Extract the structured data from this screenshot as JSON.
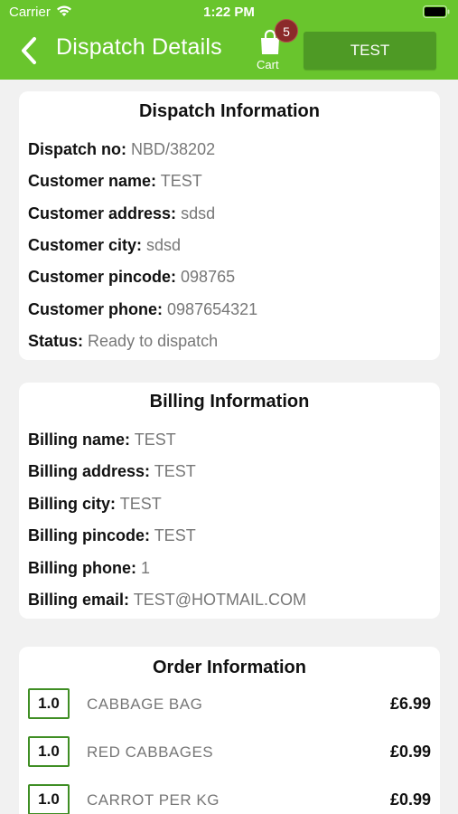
{
  "status_bar": {
    "carrier": "Carrier",
    "time": "1:22 PM"
  },
  "header": {
    "title": "Dispatch Details",
    "cart_label": "Cart",
    "cart_count": "5",
    "action_button": "TEST",
    "colors": {
      "bar": "#69c52d",
      "button": "#4e9a25",
      "badge": "#8b2a2a"
    }
  },
  "dispatch": {
    "title": "Dispatch Information",
    "rows": [
      {
        "label": "Dispatch no:",
        "value": "NBD/38202"
      },
      {
        "label": "Customer name:",
        "value": "TEST"
      },
      {
        "label": "Customer address:",
        "value": "sdsd"
      },
      {
        "label": "Customer city:",
        "value": "sdsd"
      },
      {
        "label": "Customer pincode:",
        "value": "098765"
      },
      {
        "label": "Customer phone:",
        "value": "0987654321"
      },
      {
        "label": "Status:",
        "value": "Ready to dispatch"
      }
    ]
  },
  "billing": {
    "title": "Billing Information",
    "rows": [
      {
        "label": "Billing name:",
        "value": "TEST"
      },
      {
        "label": "Billing address:",
        "value": "TEST"
      },
      {
        "label": "Billing city:",
        "value": "TEST"
      },
      {
        "label": "Billing pincode:",
        "value": "TEST"
      },
      {
        "label": "Billing phone:",
        "value": "1"
      },
      {
        "label": "Billing email:",
        "value": "TEST@HOTMAIL.COM"
      }
    ]
  },
  "order": {
    "title": "Order Information",
    "items": [
      {
        "qty": "1.0",
        "name": "CABBAGE BAG",
        "price": "£6.99"
      },
      {
        "qty": "1.0",
        "name": "RED CABBAGES",
        "price": "£0.99"
      },
      {
        "qty": "1.0",
        "name": "CARROT PER KG",
        "price": "£0.99"
      }
    ]
  }
}
